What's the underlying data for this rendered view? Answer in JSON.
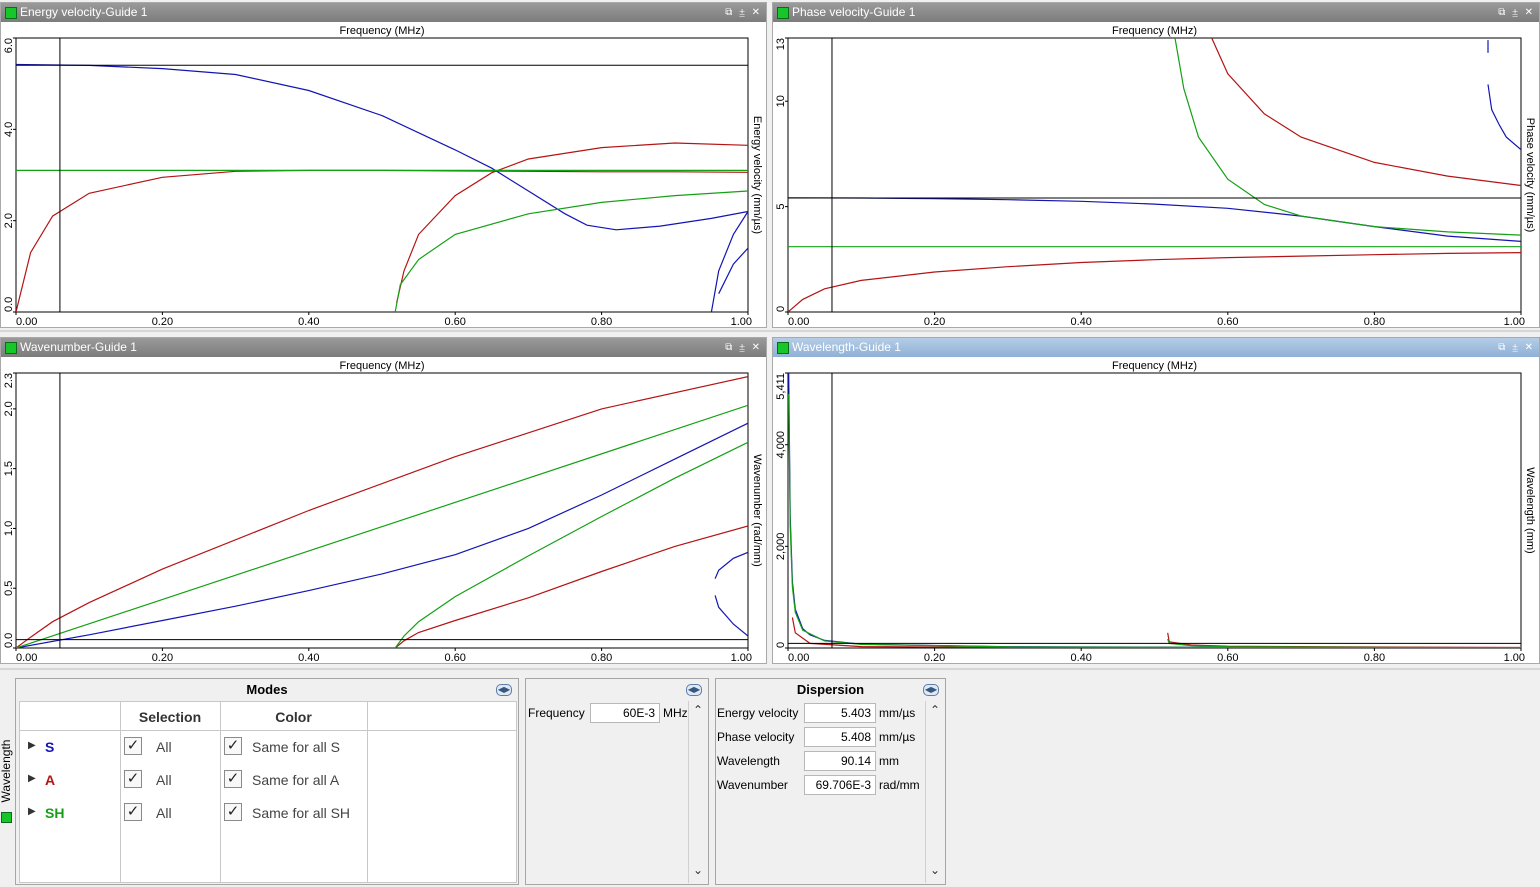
{
  "panels": {
    "energy": {
      "title": "Energy velocity-Guide 1",
      "xlabel": "Frequency (MHz)",
      "ylabel": "Energy velocity (mm/µs)"
    },
    "phase": {
      "title": "Phase velocity-Guide 1",
      "xlabel": "Frequency (MHz)",
      "ylabel": "Phase velocity (mm/µs)"
    },
    "wavenumber": {
      "title": "Wavenumber-Guide 1",
      "xlabel": "Frequency (MHz)",
      "ylabel": "Wavenumber (rad/mm)"
    },
    "wavelength": {
      "title": "Wavelength-Guide 1",
      "xlabel": "Frequency (MHz)",
      "ylabel": "Wavelength (mm)"
    }
  },
  "title_buttons": {
    "restore": "⧉",
    "pin": "⩲",
    "close": "✕"
  },
  "colors": {
    "S": "#1414b4",
    "A": "#b41414",
    "SH": "#14a014",
    "active_title": "#8fb0d6"
  },
  "chart_data": [
    {
      "type": "line",
      "title": "Energy velocity-Guide 1",
      "xlabel": "Frequency (MHz)",
      "ylabel": "Energy velocity (mm/µs)",
      "xlim": [
        0,
        1.0
      ],
      "ylim": [
        0,
        6.0
      ],
      "xticks": [
        "0.00",
        "0.20",
        "0.40",
        "0.60",
        "0.80",
        "1.00"
      ],
      "yticks": [
        "0.0",
        "2.0",
        "4.0",
        "6.0"
      ],
      "cursor": {
        "x": 0.06,
        "y": 5.403
      },
      "series": [
        {
          "name": "S",
          "color": "#1414b4",
          "points": [
            [
              0,
              5.42
            ],
            [
              0.1,
              5.4
            ],
            [
              0.2,
              5.33
            ],
            [
              0.3,
              5.2
            ],
            [
              0.4,
              4.85
            ],
            [
              0.5,
              4.3
            ],
            [
              0.6,
              3.55
            ],
            [
              0.65,
              3.15
            ],
            [
              0.7,
              2.65
            ],
            [
              0.75,
              2.15
            ],
            [
              0.78,
              1.9
            ],
            [
              0.82,
              1.8
            ],
            [
              0.88,
              1.88
            ],
            [
              0.95,
              2.05
            ],
            [
              1.0,
              2.2
            ]
          ]
        },
        {
          "name": "S",
          "color": "#1414b4",
          "points": [
            [
              0.95,
              0.0
            ],
            [
              0.96,
              0.9
            ],
            [
              0.98,
              1.7
            ],
            [
              1.0,
              2.2
            ]
          ]
        },
        {
          "name": "S",
          "color": "#1414b4",
          "points": [
            [
              0.96,
              0.4
            ],
            [
              0.98,
              1.05
            ],
            [
              1.0,
              1.4
            ]
          ]
        },
        {
          "name": "A",
          "color": "#b41414",
          "points": [
            [
              0,
              0
            ],
            [
              0.02,
              1.3
            ],
            [
              0.05,
              2.1
            ],
            [
              0.1,
              2.6
            ],
            [
              0.2,
              2.95
            ],
            [
              0.3,
              3.08
            ],
            [
              0.4,
              3.1
            ],
            [
              0.5,
              3.1
            ],
            [
              0.6,
              3.09
            ],
            [
              0.7,
              3.08
            ],
            [
              0.8,
              3.07
            ],
            [
              0.9,
              3.07
            ],
            [
              1.0,
              3.06
            ]
          ]
        },
        {
          "name": "A",
          "color": "#b41414",
          "points": [
            [
              0.52,
              0.2
            ],
            [
              0.53,
              0.9
            ],
            [
              0.55,
              1.7
            ],
            [
              0.6,
              2.55
            ],
            [
              0.65,
              3.05
            ],
            [
              0.7,
              3.35
            ],
            [
              0.8,
              3.6
            ],
            [
              0.9,
              3.7
            ],
            [
              1.0,
              3.65
            ]
          ]
        },
        {
          "name": "SH",
          "color": "#14a014",
          "points": [
            [
              0,
              3.1
            ],
            [
              0.2,
              3.1
            ],
            [
              0.4,
              3.1
            ],
            [
              0.6,
              3.1
            ],
            [
              0.8,
              3.1
            ],
            [
              1.0,
              3.1
            ]
          ]
        },
        {
          "name": "SH",
          "color": "#14a014",
          "points": [
            [
              0.518,
              0.0
            ],
            [
              0.525,
              0.6
            ],
            [
              0.55,
              1.15
            ],
            [
              0.6,
              1.7
            ],
            [
              0.7,
              2.15
            ],
            [
              0.8,
              2.4
            ],
            [
              0.9,
              2.55
            ],
            [
              1.0,
              2.65
            ]
          ]
        }
      ]
    },
    {
      "type": "line",
      "title": "Phase velocity-Guide 1",
      "xlabel": "Frequency (MHz)",
      "ylabel": "Phase velocity (mm/µs)",
      "xlim": [
        0,
        1.0
      ],
      "ylim": [
        0,
        13
      ],
      "xticks": [
        "0.00",
        "0.20",
        "0.40",
        "0.60",
        "0.80",
        "1.00"
      ],
      "yticks": [
        "0",
        "5",
        "10",
        "13"
      ],
      "cursor": {
        "x": 0.06,
        "y": 5.408
      },
      "series": [
        {
          "name": "S",
          "color": "#1414b4",
          "points": [
            [
              0,
              5.42
            ],
            [
              0.1,
              5.41
            ],
            [
              0.2,
              5.38
            ],
            [
              0.3,
              5.33
            ],
            [
              0.4,
              5.25
            ],
            [
              0.5,
              5.12
            ],
            [
              0.6,
              4.92
            ],
            [
              0.7,
              4.55
            ],
            [
              0.8,
              4.05
            ],
            [
              0.9,
              3.6
            ],
            [
              1.0,
              3.35
            ]
          ]
        },
        {
          "name": "S",
          "color": "#1414b4",
          "points": [
            [
              0.955,
              12.9
            ],
            [
              0.955,
              12.3
            ]
          ]
        },
        {
          "name": "S",
          "color": "#1414b4",
          "points": [
            [
              0.955,
              10.8
            ],
            [
              0.96,
              9.6
            ],
            [
              0.97,
              8.9
            ],
            [
              0.98,
              8.3
            ],
            [
              1.0,
              7.7
            ]
          ]
        },
        {
          "name": "A",
          "color": "#b41414",
          "points": [
            [
              0,
              0
            ],
            [
              0.02,
              0.6
            ],
            [
              0.05,
              1.1
            ],
            [
              0.1,
              1.5
            ],
            [
              0.2,
              1.9
            ],
            [
              0.3,
              2.15
            ],
            [
              0.4,
              2.35
            ],
            [
              0.5,
              2.48
            ],
            [
              0.6,
              2.58
            ],
            [
              0.7,
              2.65
            ],
            [
              0.8,
              2.72
            ],
            [
              0.9,
              2.78
            ],
            [
              1.0,
              2.82
            ]
          ]
        },
        {
          "name": "A",
          "color": "#b41414",
          "points": [
            [
              0.578,
              13.0
            ],
            [
              0.6,
              11.3
            ],
            [
              0.65,
              9.4
            ],
            [
              0.7,
              8.3
            ],
            [
              0.8,
              7.1
            ],
            [
              0.9,
              6.45
            ],
            [
              1.0,
              6.0
            ]
          ]
        },
        {
          "name": "SH",
          "color": "#14a014",
          "points": [
            [
              0,
              3.1
            ],
            [
              0.2,
              3.1
            ],
            [
              0.4,
              3.1
            ],
            [
              0.6,
              3.1
            ],
            [
              0.8,
              3.1
            ],
            [
              1.0,
              3.1
            ]
          ]
        },
        {
          "name": "SH",
          "color": "#14a014",
          "points": [
            [
              0.528,
              13.0
            ],
            [
              0.54,
              10.6
            ],
            [
              0.56,
              8.3
            ],
            [
              0.6,
              6.3
            ],
            [
              0.65,
              5.1
            ],
            [
              0.7,
              4.55
            ],
            [
              0.8,
              4.05
            ],
            [
              0.9,
              3.8
            ],
            [
              1.0,
              3.65
            ]
          ]
        }
      ]
    },
    {
      "type": "line",
      "title": "Wavenumber-Guide 1",
      "xlabel": "Frequency (MHz)",
      "ylabel": "Wavenumber (rad/mm)",
      "xlim": [
        0,
        1.0
      ],
      "ylim": [
        0,
        2.3
      ],
      "xticks": [
        "0.00",
        "0.20",
        "0.40",
        "0.60",
        "0.80",
        "1.00"
      ],
      "yticks": [
        "0.0",
        "0.5",
        "1.0",
        "1.5",
        "2.0",
        "2.3"
      ],
      "cursor": {
        "x": 0.06,
        "y": 0.0697
      },
      "series": [
        {
          "name": "S",
          "color": "#1414b4",
          "points": [
            [
              0,
              0
            ],
            [
              0.1,
              0.11
            ],
            [
              0.2,
              0.23
            ],
            [
              0.3,
              0.35
            ],
            [
              0.4,
              0.48
            ],
            [
              0.5,
              0.62
            ],
            [
              0.6,
              0.78
            ],
            [
              0.7,
              1.0
            ],
            [
              0.8,
              1.28
            ],
            [
              0.9,
              1.58
            ],
            [
              1.0,
              1.88
            ]
          ]
        },
        {
          "name": "S",
          "color": "#1414b4",
          "points": [
            [
              0.955,
              0.58
            ],
            [
              0.96,
              0.65
            ],
            [
              0.98,
              0.75
            ],
            [
              1.0,
              0.8
            ]
          ]
        },
        {
          "name": "S",
          "color": "#1414b4",
          "points": [
            [
              0.955,
              0.44
            ],
            [
              0.96,
              0.34
            ],
            [
              0.98,
              0.2
            ],
            [
              1.0,
              0.1
            ]
          ]
        },
        {
          "name": "A",
          "color": "#b41414",
          "points": [
            [
              0,
              0
            ],
            [
              0.02,
              0.09
            ],
            [
              0.05,
              0.22
            ],
            [
              0.1,
              0.38
            ],
            [
              0.2,
              0.66
            ],
            [
              0.4,
              1.15
            ],
            [
              0.6,
              1.6
            ],
            [
              0.8,
              2.0
            ],
            [
              1.0,
              2.27
            ]
          ]
        },
        {
          "name": "A",
          "color": "#b41414",
          "points": [
            [
              0.518,
              0
            ],
            [
              0.53,
              0.06
            ],
            [
              0.55,
              0.13
            ],
            [
              0.6,
              0.23
            ],
            [
              0.7,
              0.42
            ],
            [
              0.8,
              0.64
            ],
            [
              0.9,
              0.85
            ],
            [
              1.0,
              1.02
            ]
          ]
        },
        {
          "name": "SH",
          "color": "#14a014",
          "points": [
            [
              0,
              0
            ],
            [
              1.0,
              2.03
            ]
          ]
        },
        {
          "name": "SH",
          "color": "#14a014",
          "points": [
            [
              0.518,
              0
            ],
            [
              0.53,
              0.1
            ],
            [
              0.55,
              0.22
            ],
            [
              0.6,
              0.43
            ],
            [
              0.7,
              0.77
            ],
            [
              0.8,
              1.1
            ],
            [
              0.9,
              1.42
            ],
            [
              1.0,
              1.72
            ]
          ]
        }
      ]
    },
    {
      "type": "line",
      "title": "Wavelength-Guide 1",
      "xlabel": "Frequency (MHz)",
      "ylabel": "Wavelength (mm)",
      "xlim": [
        0,
        1.0
      ],
      "ylim": [
        0,
        5411
      ],
      "xticks": [
        "0.00",
        "0.20",
        "0.40",
        "0.60",
        "0.80",
        "1.00"
      ],
      "yticks": [
        "0",
        "2,000",
        "4,000",
        "5,411"
      ],
      "cursor": {
        "x": 0.06,
        "y": 90.14
      },
      "series": [
        {
          "name": "S",
          "color": "#1414b4",
          "points": [
            [
              0.001,
              5411
            ],
            [
              0.003,
              2600
            ],
            [
              0.006,
              1300
            ],
            [
              0.01,
              760
            ],
            [
              0.02,
              380
            ],
            [
              0.03,
              260
            ],
            [
              0.05,
              150
            ],
            [
              0.1,
              75
            ],
            [
              0.3,
              25
            ],
            [
              0.6,
              12
            ],
            [
              1.0,
              5
            ]
          ]
        },
        {
          "name": "A",
          "color": "#b41414",
          "points": [
            [
              0.006,
              600
            ],
            [
              0.01,
              300
            ],
            [
              0.03,
              90
            ],
            [
              0.1,
              28
            ],
            [
              0.3,
              9
            ],
            [
              0.6,
              5
            ],
            [
              1.0,
              3
            ]
          ]
        },
        {
          "name": "A",
          "color": "#b41414",
          "points": [
            [
              0.518,
              300
            ],
            [
              0.52,
              120
            ],
            [
              0.55,
              60
            ],
            [
              0.6,
              35
            ],
            [
              0.8,
              20
            ],
            [
              1.0,
              10
            ]
          ]
        },
        {
          "name": "SH",
          "color": "#14a014",
          "points": [
            [
              0.001,
              5000
            ],
            [
              0.003,
              2400
            ],
            [
              0.006,
              1200
            ],
            [
              0.01,
              700
            ],
            [
              0.02,
              350
            ],
            [
              0.05,
              140
            ],
            [
              0.1,
              70
            ],
            [
              0.3,
              22
            ],
            [
              0.6,
              10
            ],
            [
              1.0,
              4
            ]
          ]
        },
        {
          "name": "SH",
          "color": "#14a014",
          "points": [
            [
              0.518,
              180
            ],
            [
              0.52,
              90
            ],
            [
              0.55,
              45
            ],
            [
              0.6,
              25
            ],
            [
              0.8,
              12
            ],
            [
              1.0,
              6
            ]
          ]
        }
      ]
    }
  ],
  "modes_panel": {
    "title": "Modes",
    "col_selection": "Selection",
    "col_color": "Color",
    "rows": [
      {
        "mode": "S",
        "selection": "All",
        "color_label": "Same for all S"
      },
      {
        "mode": "A",
        "selection": "All",
        "color_label": "Same for all A"
      },
      {
        "mode": "SH",
        "selection": "All",
        "color_label": "Same for all SH"
      }
    ],
    "side_tab": "Wavelength"
  },
  "frequency_panel": {
    "label": "Frequency",
    "value": "60E-3",
    "unit": "MHz"
  },
  "dispersion_panel": {
    "title": "Dispersion",
    "rows": [
      {
        "label": "Energy velocity",
        "value": "5.403",
        "unit": "mm/µs"
      },
      {
        "label": "Phase velocity",
        "value": "5.408",
        "unit": "mm/µs"
      },
      {
        "label": "Wavelength",
        "value": "90.14",
        "unit": "mm"
      },
      {
        "label": "Wavenumber",
        "value": "69.706E-3",
        "unit": "rad/mm"
      }
    ]
  }
}
